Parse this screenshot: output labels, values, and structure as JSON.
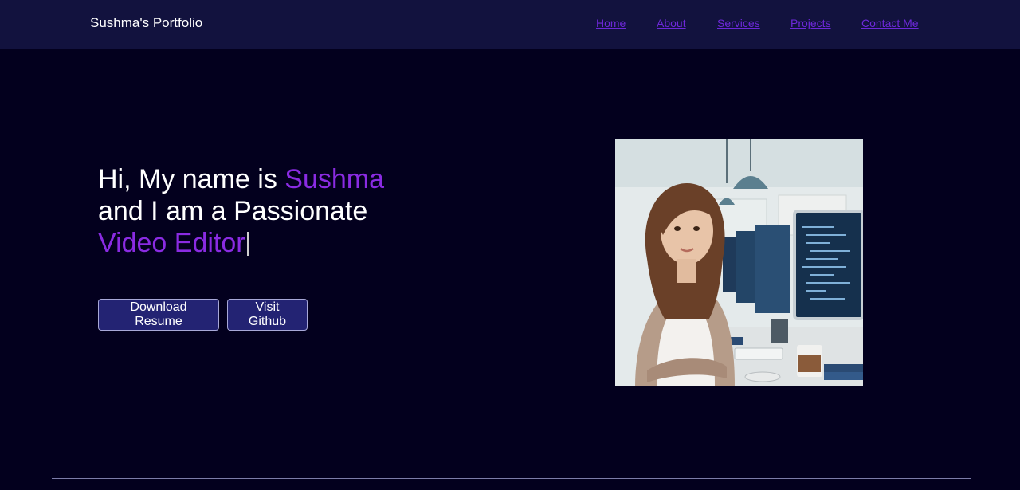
{
  "navbar": {
    "brand": "Sushma's Portfolio",
    "links": [
      "Home",
      "About",
      "Services",
      "Projects",
      "Contact Me"
    ]
  },
  "hero": {
    "greeting": "Hi, My name is ",
    "name": "Sushma",
    "line2": "and I am a Passionate",
    "role": "Video Editor"
  },
  "buttons": {
    "resume": "Download Resume",
    "github": "Visit Github"
  },
  "colors": {
    "background": "#03001e",
    "navbar": "#12123e",
    "accent": "#8a2be2",
    "link": "#6d28d9",
    "button": "#232373"
  },
  "image": {
    "icon": "profile-photo"
  }
}
